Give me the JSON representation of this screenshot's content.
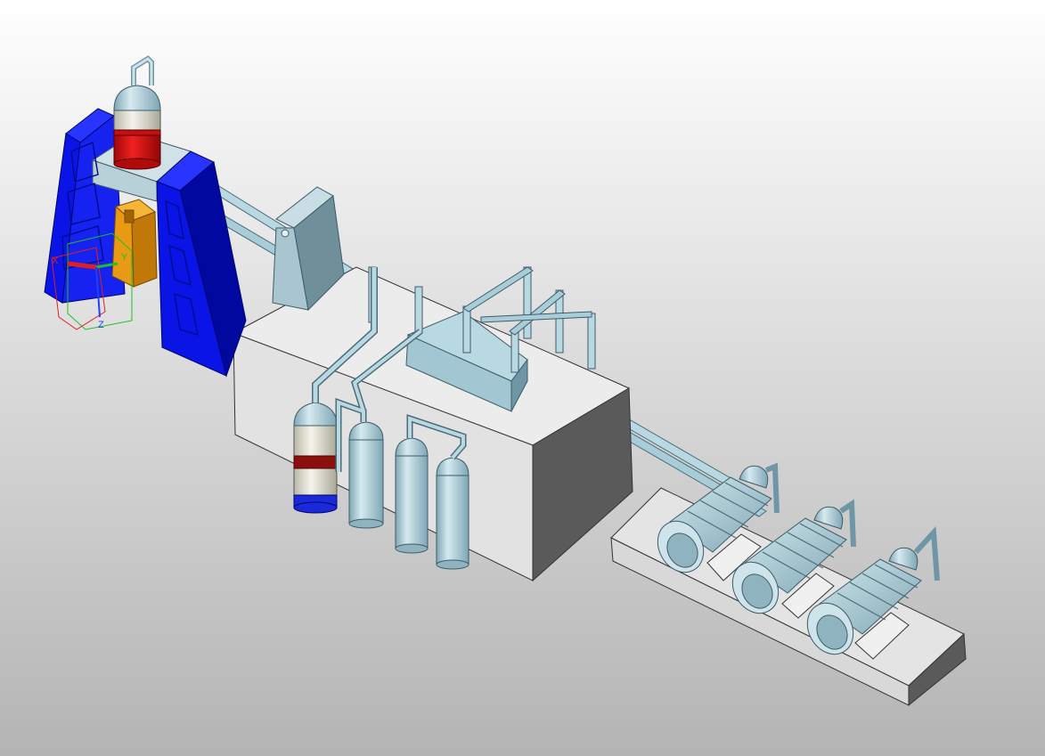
{
  "viewport": {
    "background_top": "#ffffff",
    "background_bottom": "#b4b4b4"
  },
  "triad": {
    "axis_labels": [
      "X",
      "Y",
      "Z"
    ],
    "x_color": "#e02020",
    "y_color": "#20c020",
    "z_color": "#2040ff"
  },
  "colors": {
    "press_frame": "#0a14e6",
    "press_frame_dark": "#0008a0",
    "die_block": "#e89a14",
    "cylinder_red": "#dc1010",
    "steel_light": "#b8d8e2",
    "steel_mid": "#9cc2ce",
    "steel_dark": "#6f96a4",
    "housing_light": "#ececec",
    "housing_mid": "#d4d4d4",
    "housing_dark": "#5a5a5a",
    "accumulator_band": "#8a1010",
    "accumulator_base": "#1a2ad8"
  },
  "parts": [
    "press-frame",
    "main-cylinder",
    "die-block",
    "valve-stand",
    "hydraulic-tank",
    "manifold-block",
    "accumulator",
    "gas-bottle",
    "pump-motor",
    "motor-base",
    "pressure-line"
  ]
}
